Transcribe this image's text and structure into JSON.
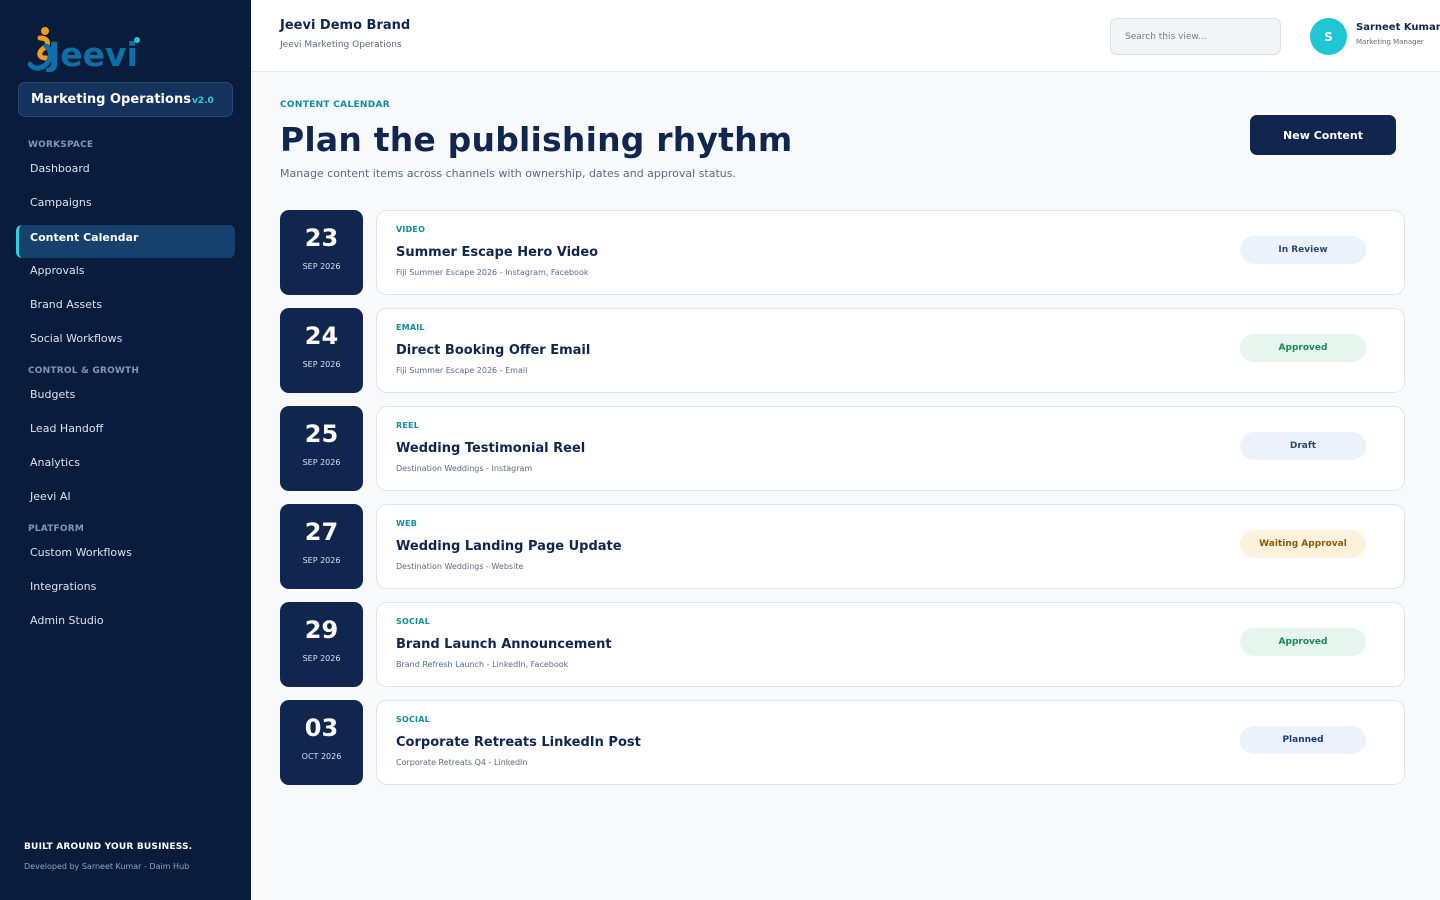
{
  "sidebar": {
    "module_title": "Marketing Operations",
    "module_version": "v2.0",
    "sections": [
      {
        "label": "WORKSPACE"
      },
      {
        "label": "CONTROL & GROWTH"
      },
      {
        "label": "PLATFORM"
      }
    ],
    "items": [
      {
        "label": "Dashboard"
      },
      {
        "label": "Campaigns"
      },
      {
        "label": "Content Calendar",
        "active": true
      },
      {
        "label": "Approvals"
      },
      {
        "label": "Brand Assets"
      },
      {
        "label": "Social Workflows"
      },
      {
        "label": "Budgets"
      },
      {
        "label": "Lead Handoff"
      },
      {
        "label": "Analytics"
      },
      {
        "label": "Jeevi AI"
      },
      {
        "label": "Custom Workflows"
      },
      {
        "label": "Integrations"
      },
      {
        "label": "Admin Studio"
      }
    ],
    "footer_tagline": "BUILT AROUND YOUR BUSINESS.",
    "footer_credit": "Developed by Sarneet Kumar - Daim Hub"
  },
  "header": {
    "brand_name": "Jeevi Demo Brand",
    "brand_sub": "Jeevi Marketing Operations",
    "search_placeholder": "Search this view...",
    "user_initial": "S",
    "user_name": "Sarneet Kumar",
    "user_role": "Marketing Manager"
  },
  "main": {
    "eyebrow": "CONTENT CALENDAR",
    "title": "Plan the publishing rhythm",
    "description": "Manage content items across channels with ownership, dates and approval status.",
    "new_button": "New Content",
    "items": [
      {
        "day": "23",
        "month": "SEP 2026",
        "type": "VIDEO",
        "title": "Summer Escape Hero Video",
        "meta": "Fiji Summer Escape 2026 - Instagram, Facebook",
        "status": "In Review",
        "status_kind": "review"
      },
      {
        "day": "24",
        "month": "SEP 2026",
        "type": "EMAIL",
        "title": "Direct Booking Offer Email",
        "meta": "Fiji Summer Escape 2026 - Email",
        "status": "Approved",
        "status_kind": "approved"
      },
      {
        "day": "25",
        "month": "SEP 2026",
        "type": "REEL",
        "title": "Wedding Testimonial Reel",
        "meta": "Destination Weddings - Instagram",
        "status": "Draft",
        "status_kind": "draft"
      },
      {
        "day": "27",
        "month": "SEP 2026",
        "type": "WEB",
        "title": "Wedding Landing Page Update",
        "meta": "Destination Weddings - Website",
        "status": "Waiting Approval",
        "status_kind": "waiting"
      },
      {
        "day": "29",
        "month": "SEP 2026",
        "type": "SOCIAL",
        "title": "Brand Launch Announcement",
        "meta": "Brand Refresh Launch - LinkedIn, Facebook",
        "status": "Approved",
        "status_kind": "approved"
      },
      {
        "day": "03",
        "month": "OCT 2026",
        "type": "SOCIAL",
        "title": "Corporate Retreats LinkedIn Post",
        "meta": "Corporate Retreats Q4 - LinkedIn",
        "status": "Planned",
        "status_kind": "planned"
      }
    ]
  },
  "colors": {
    "sidebar_bg": "#0a1c3b",
    "navy": "#10264f",
    "accent_teal": "#2ed0dd",
    "review_bg": "#ecf2fc",
    "review_fg": "#2c4870",
    "approved_bg": "#e6f5ee",
    "approved_fg": "#1a8a56",
    "draft_bg": "#ecf2fc",
    "draft_fg": "#2c4870",
    "waiting_bg": "#fdf3dc",
    "waiting_fg": "#8a5a0c",
    "planned_bg": "#ecf2fc",
    "planned_fg": "#1d3d7a"
  }
}
